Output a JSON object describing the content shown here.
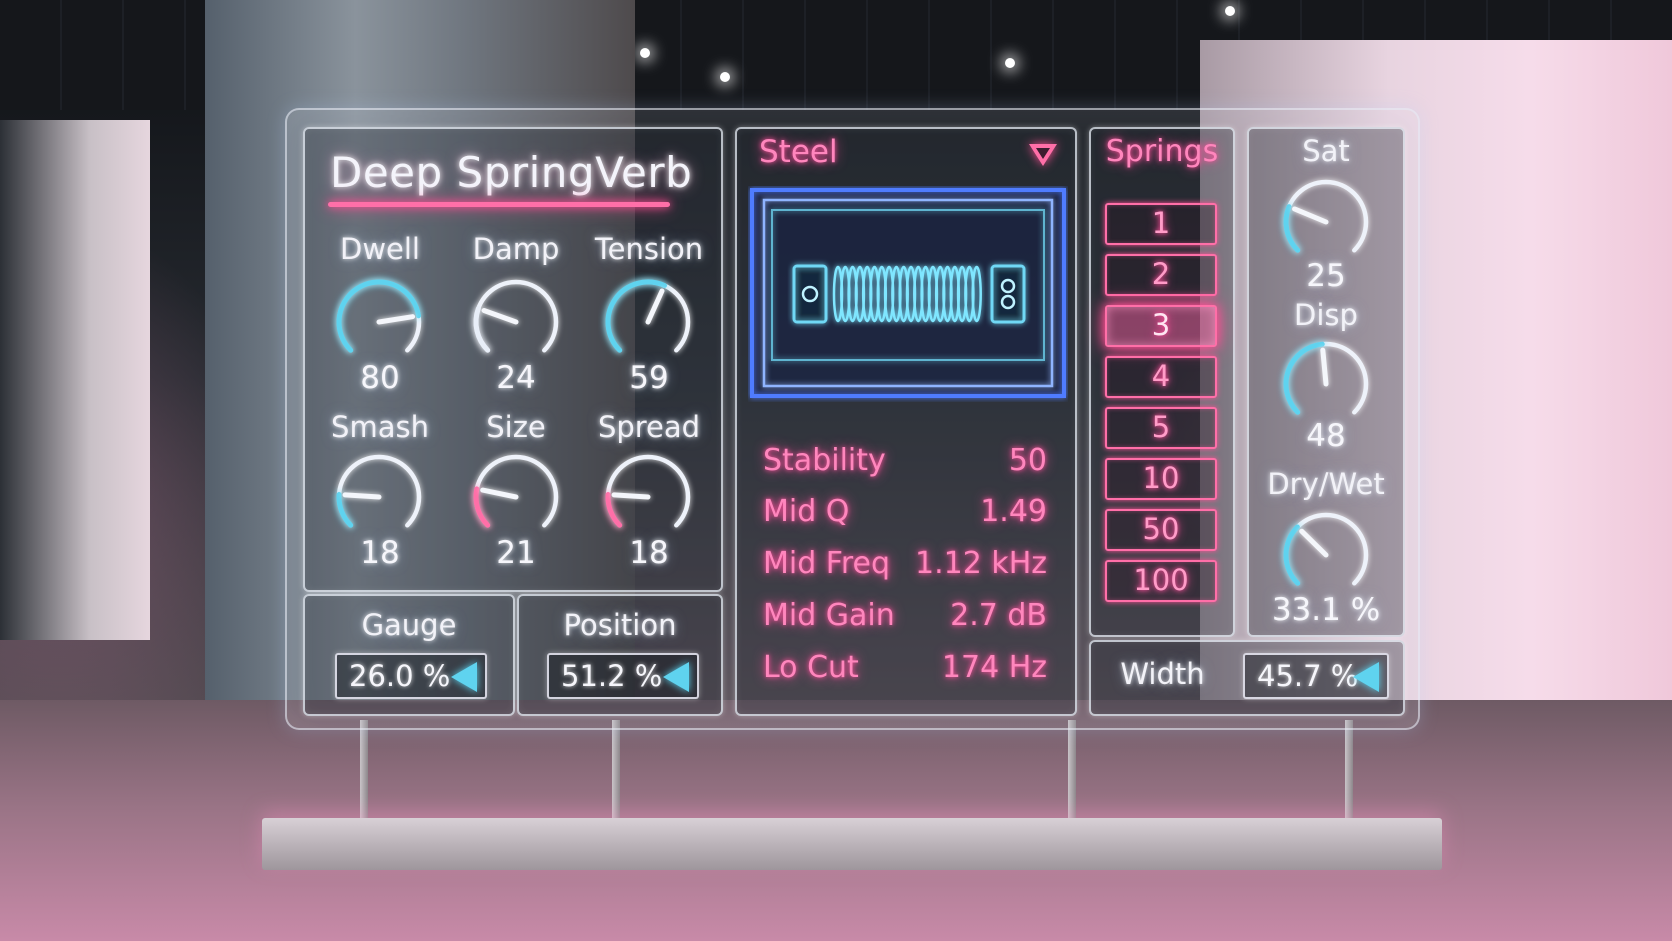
{
  "plugin": {
    "title": "Deep SpringVerb"
  },
  "knobs_left": [
    {
      "label": "Dwell",
      "value": "80",
      "level": 0.8,
      "color": "#5fd3ef"
    },
    {
      "label": "Damp",
      "value": "24",
      "level": 0.24,
      "color": "#e8eef8"
    },
    {
      "label": "Tension",
      "value": "59",
      "level": 0.59,
      "color": "#5fd3ef"
    },
    {
      "label": "Smash",
      "value": "18",
      "level": 0.18,
      "color": "#5fd3ef"
    },
    {
      "label": "Size",
      "value": "21",
      "level": 0.21,
      "color": "#ff6fa8"
    },
    {
      "label": "Spread",
      "value": "18",
      "level": 0.18,
      "color": "#ff6fa8"
    }
  ],
  "gauge": {
    "label": "Gauge",
    "value": "26.0 %"
  },
  "position": {
    "label": "Position",
    "value": "51.2 %"
  },
  "material": {
    "selected": "Steel",
    "icon": "chevron-down-icon"
  },
  "params": [
    {
      "name": "Stability",
      "value": "50"
    },
    {
      "name": "Mid Q",
      "value": "1.49"
    },
    {
      "name": "Mid Freq",
      "value": "1.12 kHz"
    },
    {
      "name": "Mid Gain",
      "value": "2.7 dB"
    },
    {
      "name": "Lo Cut",
      "value": "174 Hz"
    }
  ],
  "springs": {
    "label": "Springs",
    "options": [
      "1",
      "2",
      "3",
      "4",
      "5",
      "10",
      "50",
      "100"
    ],
    "selected": "3"
  },
  "knobs_right": [
    {
      "label": "Sat",
      "value": "25",
      "level": 0.25,
      "color": "#5fd3ef"
    },
    {
      "label": "Disp",
      "value": "48",
      "level": 0.48,
      "color": "#5fd3ef"
    },
    {
      "label": "Dry/Wet",
      "value": "33.1 %",
      "level": 0.331,
      "color": "#5fd3ef"
    }
  ],
  "width": {
    "label": "Width",
    "value": "45.7 %"
  },
  "colors": {
    "accent_pink": "#ff6fa8",
    "accent_cyan": "#5fd3ef",
    "accent_blue": "#4f7bff"
  }
}
